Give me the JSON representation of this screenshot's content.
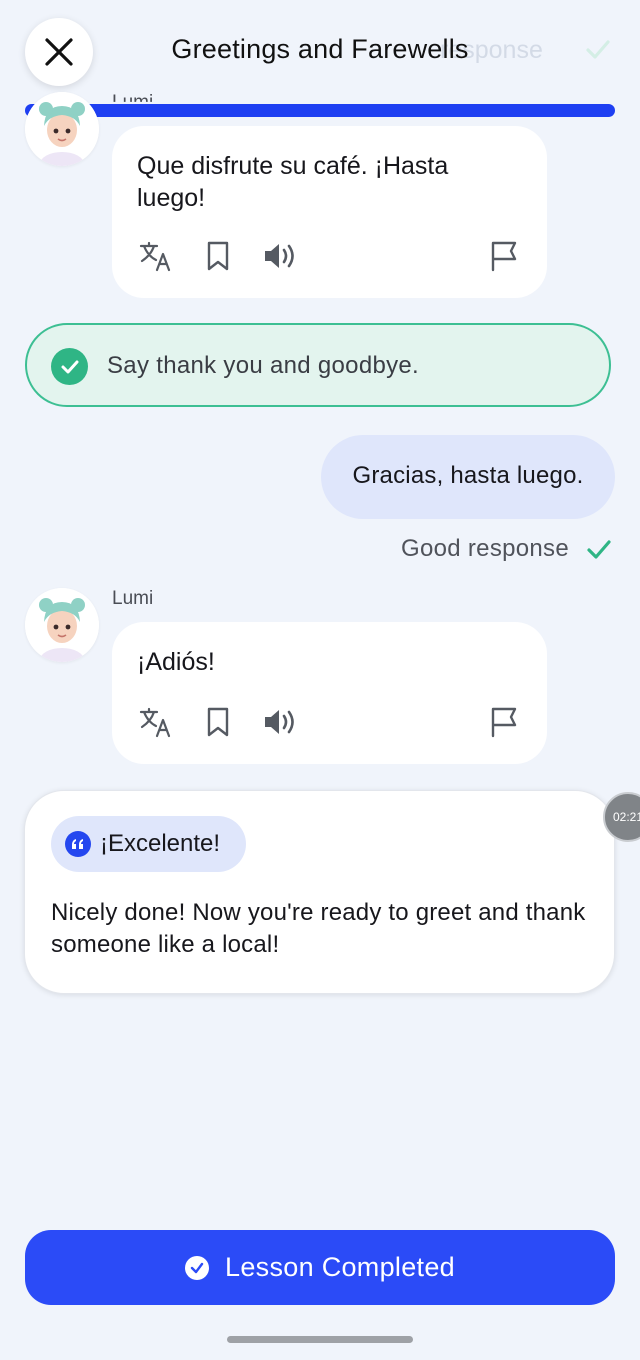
{
  "header": {
    "title": "Greetings and Farewells",
    "ghost_status": "response",
    "progress": 1.0
  },
  "messages": [
    {
      "sender": "Lumi",
      "text": "Que disfrute su café. ¡Hasta luego!",
      "actions": [
        "translate-icon",
        "bookmark-icon",
        "speaker-icon",
        "flag-icon"
      ]
    },
    {
      "sender": "Lumi",
      "text": "¡Adiós!",
      "actions": [
        "translate-icon",
        "bookmark-icon",
        "speaker-icon",
        "flag-icon"
      ]
    }
  ],
  "task": {
    "text": "Say thank you and goodbye.",
    "status": "completed"
  },
  "user_reply": {
    "text": "Gracias, hasta luego.",
    "status": "Good response"
  },
  "feedback": {
    "label": "¡Excelente!",
    "text": "Nicely done! Now you're ready to greet and thank someone like a local!"
  },
  "timer": "02:21",
  "cta": {
    "label": "Lesson Completed"
  },
  "colors": {
    "accent": "#2b4bf7",
    "success": "#2fb585",
    "background": "#f0f4fb",
    "user_bubble": "#dfe6fb"
  }
}
